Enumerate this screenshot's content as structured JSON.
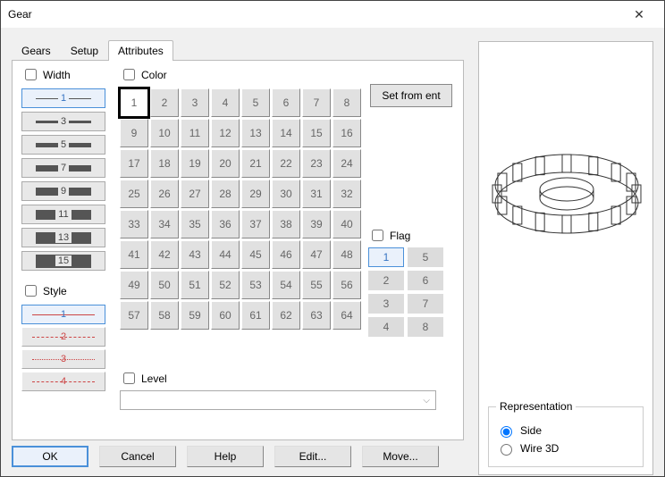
{
  "window": {
    "title": "Gear"
  },
  "tabs": [
    "Gears",
    "Setup",
    "Attributes"
  ],
  "active_tab": 2,
  "width": {
    "label": "Width",
    "checked": false,
    "values": [
      1,
      3,
      5,
      7,
      9,
      11,
      13,
      15
    ],
    "selected": 1
  },
  "style": {
    "label": "Style",
    "checked": false,
    "values": [
      1,
      2,
      3,
      4
    ],
    "selected": 1
  },
  "color": {
    "label": "Color",
    "checked": false,
    "count": 64,
    "selected": 1
  },
  "set_from_ent": "Set from ent",
  "flag": {
    "label": "Flag",
    "checked": false,
    "values": [
      1,
      2,
      3,
      4,
      5,
      6,
      7,
      8
    ],
    "selected": 1
  },
  "level": {
    "label": "Level",
    "checked": false,
    "value": ""
  },
  "buttons": {
    "ok": "OK",
    "cancel": "Cancel",
    "help": "Help",
    "edit": "Edit...",
    "move": "Move..."
  },
  "representation": {
    "legend": "Representation",
    "options": {
      "side": "Side",
      "wire3d": "Wire 3D"
    },
    "selected": "side"
  }
}
